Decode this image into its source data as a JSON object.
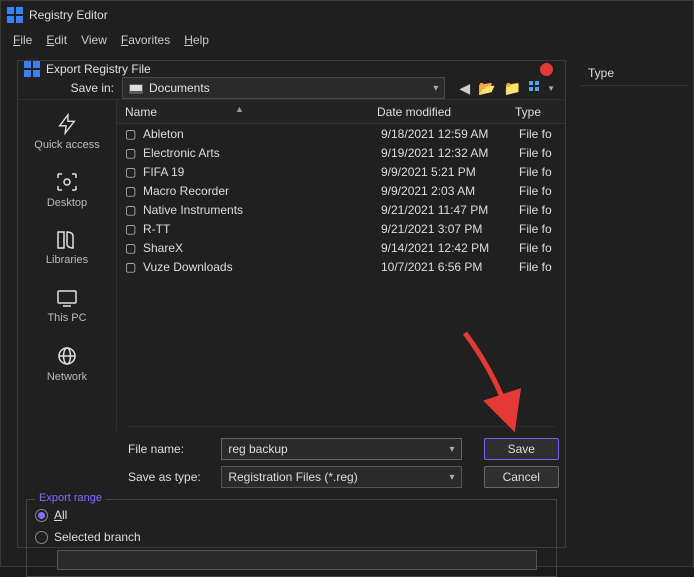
{
  "app": {
    "title": "Registry Editor"
  },
  "menu": {
    "file": "File",
    "edit": "Edit",
    "view": "View",
    "favorites": "Favorites",
    "help": "Help"
  },
  "back_column": "Type",
  "dialog": {
    "title": "Export Registry File",
    "save_in_label": "Save in:",
    "save_in_value": "Documents",
    "columns": {
      "name": "Name",
      "date": "Date modified",
      "type": "Type"
    },
    "places": {
      "quick": "Quick access",
      "desktop": "Desktop",
      "libraries": "Libraries",
      "thispc": "This PC",
      "network": "Network"
    },
    "rows": [
      {
        "name": "Ableton",
        "date": "9/18/2021 12:59 AM",
        "type": "File fo"
      },
      {
        "name": "Electronic Arts",
        "date": "9/19/2021 12:32 AM",
        "type": "File fo"
      },
      {
        "name": "FIFA 19",
        "date": "9/9/2021 5:21 PM",
        "type": "File fo"
      },
      {
        "name": "Macro Recorder",
        "date": "9/9/2021 2:03 AM",
        "type": "File fo"
      },
      {
        "name": "Native Instruments",
        "date": "9/21/2021 11:47 PM",
        "type": "File fo"
      },
      {
        "name": "R-TT",
        "date": "9/21/2021 3:07 PM",
        "type": "File fo"
      },
      {
        "name": "ShareX",
        "date": "9/14/2021 12:42 PM",
        "type": "File fo"
      },
      {
        "name": "Vuze Downloads",
        "date": "10/7/2021 6:56 PM",
        "type": "File fo"
      }
    ],
    "file_name_label": "File name:",
    "file_name_value": "reg backup",
    "save_as_type_label": "Save as type:",
    "save_as_type_value": "Registration Files (*.reg)",
    "save": "Save",
    "cancel": "Cancel",
    "export_range": {
      "legend": "Export range",
      "all": "All",
      "selected": "Selected branch"
    }
  }
}
